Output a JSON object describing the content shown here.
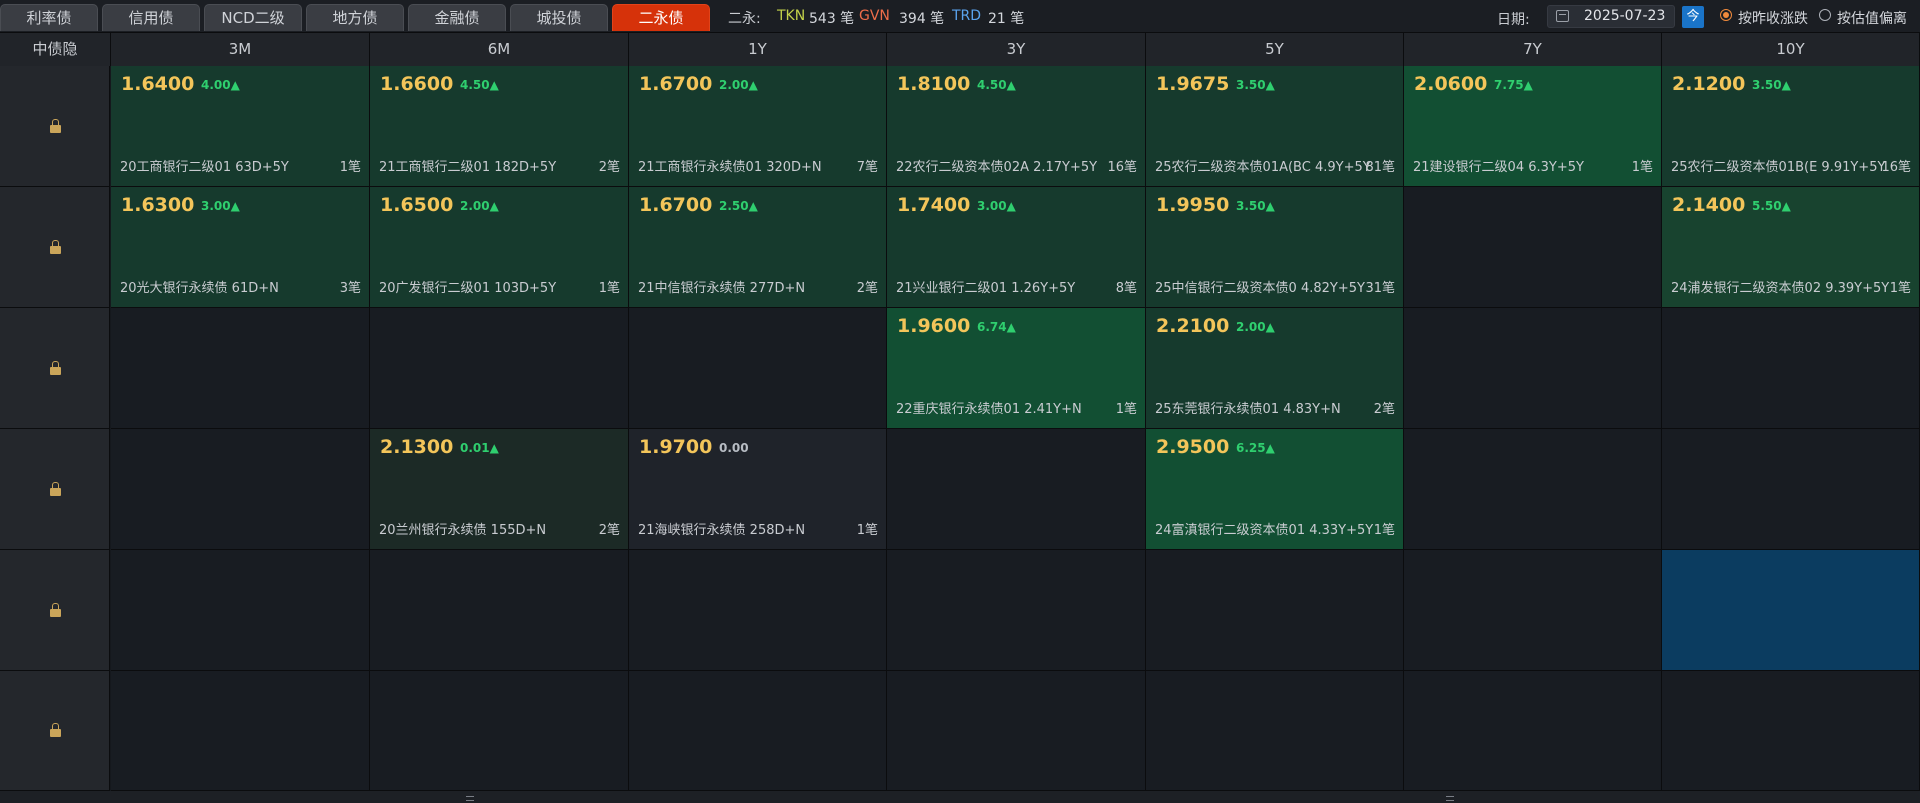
{
  "tabs": [
    {
      "label": "利率债",
      "active": false
    },
    {
      "label": "信用债",
      "active": false
    },
    {
      "label": "NCD二级",
      "active": false
    },
    {
      "label": "地方债",
      "active": false
    },
    {
      "label": "金融债",
      "active": false
    },
    {
      "label": "城投债",
      "active": false
    },
    {
      "label": "二永债",
      "active": true
    }
  ],
  "stats": {
    "prefix": "二永:",
    "tkn_label": "TKN",
    "tkn_value": "543 笔",
    "gvn_label": "GVN",
    "gvn_value": "394 笔",
    "trd_label": "TRD",
    "trd_value": "21 笔"
  },
  "date": {
    "label": "日期:",
    "value": "2025-07-23",
    "today_label": "今"
  },
  "radios": [
    {
      "label": "按昨收涨跌",
      "checked": true
    },
    {
      "label": "按估值偏离",
      "checked": false
    }
  ],
  "grid": {
    "corner_label": "中债隐",
    "columns": [
      "3M",
      "6M",
      "1Y",
      "3Y",
      "5Y",
      "7Y",
      "10Y"
    ],
    "rows": [
      [
        {
          "yield": "1.6400",
          "change": "4.00▲",
          "bond": "20工商银行二级01 63D+5Y",
          "count": "1笔"
        },
        {
          "yield": "1.6600",
          "change": "4.50▲",
          "bond": "21工商银行二级01 182D+5Y",
          "count": "2笔"
        },
        {
          "yield": "1.6700",
          "change": "2.00▲",
          "bond": "21工商银行永续债01 320D+N",
          "count": "7笔"
        },
        {
          "yield": "1.8100",
          "change": "4.50▲",
          "bond": "22农行二级资本债02A 2.17Y+5Y",
          "count": "16笔"
        },
        {
          "yield": "1.9675",
          "change": "3.50▲",
          "bond": "25农行二级资本债01A(BC 4.9Y+5Y",
          "count": "81笔"
        },
        {
          "yield": "2.0600",
          "change": "7.75▲",
          "bond": "21建设银行二级04 6.3Y+5Y",
          "count": "1笔"
        },
        {
          "yield": "2.1200",
          "change": "3.50▲",
          "bond": "25农行二级资本债01B(E 9.91Y+5Y",
          "count": "16笔"
        }
      ],
      [
        {
          "yield": "1.6300",
          "change": "3.00▲",
          "bond": "20光大银行永续债 61D+N",
          "count": "3笔"
        },
        {
          "yield": "1.6500",
          "change": "2.00▲",
          "bond": "20广发银行二级01 103D+5Y",
          "count": "1笔"
        },
        {
          "yield": "1.6700",
          "change": "2.50▲",
          "bond": "21中信银行永续债 277D+N",
          "count": "2笔"
        },
        {
          "yield": "1.7400",
          "change": "3.00▲",
          "bond": "21兴业银行二级01 1.26Y+5Y",
          "count": "8笔"
        },
        {
          "yield": "1.9950",
          "change": "3.50▲",
          "bond": "25中信银行二级资本债0 4.82Y+5Y",
          "count": "31笔"
        },
        null,
        {
          "yield": "2.1400",
          "change": "5.50▲",
          "bond": "24浦发银行二级资本债02 9.39Y+5Y",
          "count": "1笔"
        }
      ],
      [
        null,
        null,
        null,
        {
          "yield": "1.9600",
          "change": "6.74▲",
          "bond": "22重庆银行永续债01 2.41Y+N",
          "count": "1笔"
        },
        {
          "yield": "2.2100",
          "change": "2.00▲",
          "bond": "25东莞银行永续债01 4.83Y+N",
          "count": "2笔"
        },
        null,
        null
      ],
      [
        null,
        {
          "yield": "2.1300",
          "change": "0.01▲",
          "bond": "20兰州银行永续债 155D+N",
          "count": "2笔"
        },
        {
          "yield": "1.9700",
          "change": "0.00",
          "bond": "21海峡银行永续债 258D+N",
          "count": "1笔"
        },
        null,
        {
          "yield": "2.9500",
          "change": "6.25▲",
          "bond": "24富滇银行二级资本债01 4.33Y+5Y",
          "count": "1笔"
        },
        null,
        null
      ],
      [
        null,
        null,
        null,
        null,
        null,
        null,
        null
      ],
      [
        null,
        null,
        null,
        null,
        null,
        null,
        null
      ]
    ]
  },
  "colors": {
    "accent_tab": "#d6320a",
    "yield": "#f3c55a",
    "up": "#2fcf6f",
    "lock": "#caa55a",
    "selected_cell": "#0b3c60"
  },
  "icons": {
    "row_lock": "lock-icon",
    "date": "calendar-icon"
  }
}
